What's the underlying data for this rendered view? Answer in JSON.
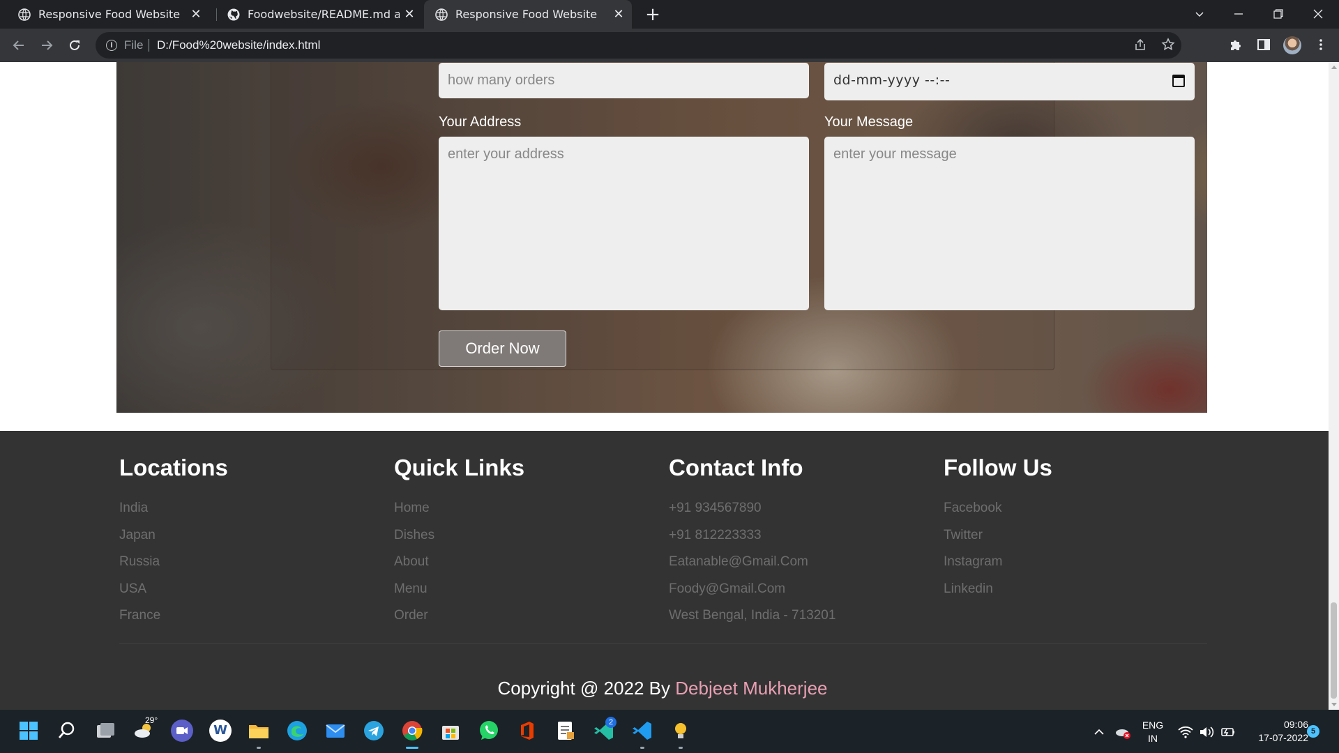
{
  "browser": {
    "tabs": [
      {
        "title": "Responsive Food Website",
        "active": false,
        "icon": "globe-icon"
      },
      {
        "title": "Foodwebsite/README.md at mai",
        "active": false,
        "icon": "github-icon"
      },
      {
        "title": "Responsive Food Website",
        "active": true,
        "icon": "globe-icon"
      }
    ],
    "close_glyph": "✕",
    "new_tab_glyph": "+",
    "address": {
      "scheme_label": "File",
      "url": "D:/Food%20website/index.html"
    }
  },
  "order_form": {
    "orders_placeholder": "how many orders",
    "datetime_placeholder": "dd-mm-yyyy --:--",
    "address_label": "Your Address",
    "address_placeholder": "enter your address",
    "message_label": "Your Message",
    "message_placeholder": "enter your message",
    "submit_label": "Order Now"
  },
  "footer": {
    "columns": [
      {
        "heading": "Locations",
        "links": [
          "India",
          "Japan",
          "Russia",
          "USA",
          "France"
        ]
      },
      {
        "heading": "Quick Links",
        "links": [
          "Home",
          "Dishes",
          "About",
          "Menu",
          "Order"
        ]
      },
      {
        "heading": "Contact Info",
        "links": [
          "+91 934567890",
          "+91 812223333",
          "Eatanable@Gmail.Com",
          "Foody@Gmail.Com",
          "West Bengal, India - 713201"
        ]
      },
      {
        "heading": "Follow Us",
        "links": [
          "Facebook",
          "Twitter",
          "Instagram",
          "Linkedin"
        ]
      }
    ],
    "copyright_prefix": "Copyright @ 2022 By ",
    "copyright_author": "Debjeet Mukherjee",
    "author_color": "#e89fb2"
  },
  "taskbar": {
    "weather_temp": "29°",
    "telegram_badge": "2",
    "language": "ENG",
    "region": "IN",
    "time": "09:06",
    "date": "17-07-2022",
    "notification_count": "5"
  }
}
